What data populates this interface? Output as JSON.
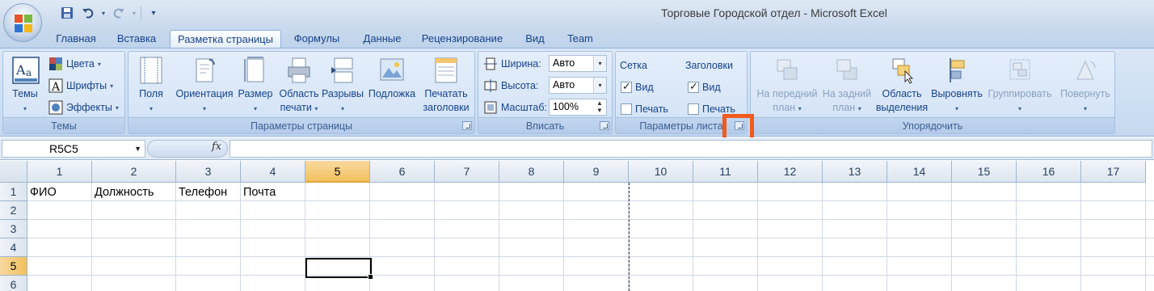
{
  "window": {
    "title": "Торговые Городской отдел - Microsoft Excel"
  },
  "quick_access": [
    "save-icon",
    "undo-icon",
    "redo-icon",
    "customize-icon"
  ],
  "tabs": [
    "Главная",
    "Вставка",
    "Разметка страницы",
    "Формулы",
    "Данные",
    "Рецензирование",
    "Вид",
    "Team"
  ],
  "active_tab": "Разметка страницы",
  "ribbon": {
    "themes": {
      "label": "Темы",
      "big": "Темы",
      "colors": "Цвета",
      "fonts": "Шрифты",
      "effects": "Эффекты"
    },
    "page_setup": {
      "label": "Параметры страницы",
      "margins": "Поля",
      "orientation": "Ориентация",
      "size": "Размер",
      "print_area_1": "Область",
      "print_area_2": "печати",
      "breaks": "Разрывы",
      "background": "Подложка",
      "print_titles_1": "Печатать",
      "print_titles_2": "заголовки"
    },
    "scale_to_fit": {
      "label": "Вписать",
      "width_label": "Ширина:",
      "width_value": "Авто",
      "height_label": "Высота:",
      "height_value": "Авто",
      "scale_label": "Масштаб:",
      "scale_value": "100%"
    },
    "sheet_options": {
      "label": "Параметры листа",
      "gridlines": "Сетка",
      "headings": "Заголовки",
      "view": "Вид",
      "print": "Печать",
      "gridlines_view": true,
      "gridlines_print": false,
      "headings_view": true,
      "headings_print": false
    },
    "arrange": {
      "label": "Упорядочить",
      "bring_forward_1": "На передний",
      "bring_forward_2": "план",
      "send_backward_1": "На задний",
      "send_backward_2": "план",
      "selection_pane_1": "Область",
      "selection_pane_2": "выделения",
      "align": "Выровнять",
      "group": "Группировать",
      "rotate": "Повернуть"
    }
  },
  "formula_bar": {
    "name_box": "R5C5",
    "fx": "fx",
    "content": ""
  },
  "grid": {
    "columns": [
      "1",
      "2",
      "3",
      "4",
      "5",
      "6",
      "7",
      "8",
      "9",
      "10",
      "11",
      "12",
      "13",
      "14",
      "15",
      "16",
      "17"
    ],
    "rows": [
      "1",
      "2",
      "3",
      "4",
      "5",
      "6"
    ],
    "selected_column": "5",
    "selected_row": "5",
    "cells": {
      "r1c1": "ФИО",
      "r1c2": "Должность",
      "r1c3": "Телефон",
      "r1c4": "Почта"
    }
  },
  "colors": {
    "accent": "#f05b1e",
    "selection": "#f1c15f"
  }
}
